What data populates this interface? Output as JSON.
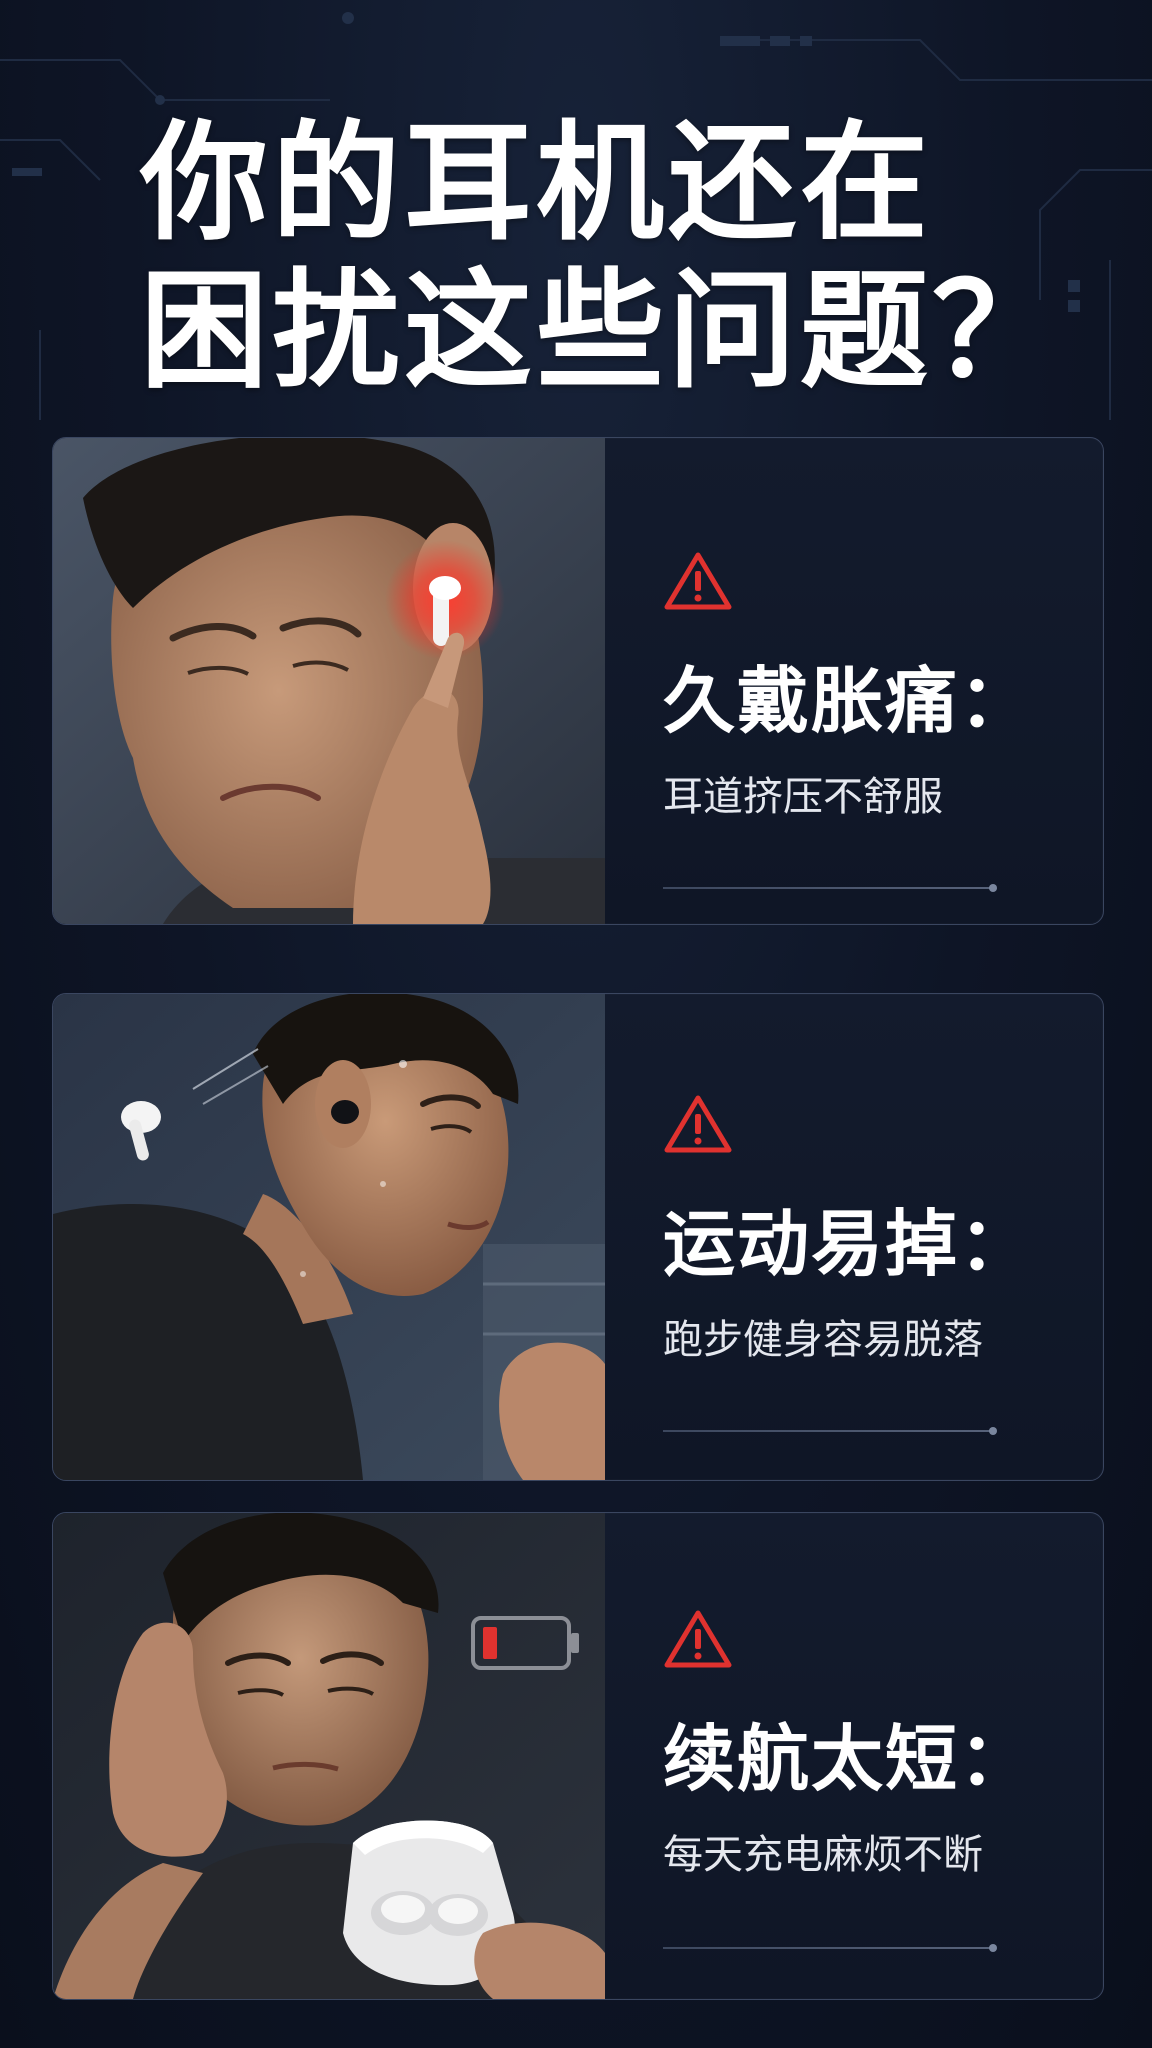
{
  "headline": {
    "line1": "你的耳机还在",
    "line2": "困扰这些问题？"
  },
  "cards": [
    {
      "icon": "warning-triangle-icon",
      "title": "久戴胀痛：",
      "description": "耳道挤压不舒服",
      "photo": "man-pressing-painful-ear-with-earbud"
    },
    {
      "icon": "warning-triangle-icon",
      "title": "运动易掉：",
      "description": "跑步健身容易脱落",
      "photo": "running-man-earbud-falling-out"
    },
    {
      "icon": "warning-triangle-icon",
      "title": "续航太短：",
      "description": "每天充电麻烦不断",
      "photo": "tired-man-holding-charging-case-low-battery"
    }
  ],
  "colors": {
    "background": "#0d1424",
    "accent_red": "#e0322f",
    "card_border": "#3a4660",
    "text": "#ffffff"
  }
}
